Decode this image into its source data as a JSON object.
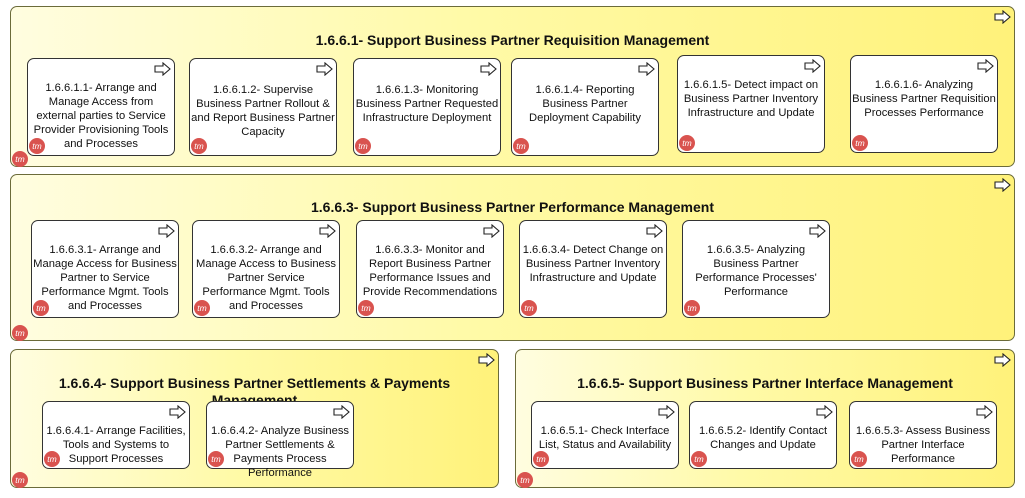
{
  "badge": "tm",
  "groups": [
    {
      "title": "1.6.6.1- Support Business Partner Requisition Management",
      "processes": [
        "1.6.6.1.1- Arrange and Manage Access from external parties to Service Provider Provisioning Tools and Processes",
        "1.6.6.1.2- Supervise Business Partner Rollout & and Report Business Partner Capacity",
        "1.6.6.1.3- Monitoring Business Partner Requested Infrastructure Deployment",
        "1.6.6.1.4- Reporting Business Partner Deployment Capability",
        "1.6.6.1.5- Detect impact on Business Partner Inventory Infrastructure and Update",
        "1.6.6.1.6- Analyzing Business Partner Requisition Processes Performance"
      ]
    },
    {
      "title": "1.6.6.3- Support Business Partner Performance Management",
      "processes": [
        "1.6.6.3.1- Arrange and Manage Access for Business Partner to Service Performance Mgmt. Tools and Processes",
        "1.6.6.3.2- Arrange and Manage Access to Business Partner Service Performance Mgmt. Tools and Processes",
        "1.6.6.3.3- Monitor and Report Business Partner Performance Issues and Provide Recommendations",
        "1.6.6.3.4- Detect Change on Business Partner Inventory Infrastructure and Update",
        "1.6.6.3.5- Analyzing Business Partner Performance Processes' Performance"
      ]
    },
    {
      "title": "1.6.6.4- Support Business Partner Settlements & Payments Management",
      "processes": [
        "1.6.6.4.1- Arrange Facilities, Tools and Systems to Support Processes",
        "1.6.6.4.2- Analyze Business Partner Settlements & Payments Process Performance"
      ]
    },
    {
      "title": "1.6.6.5- Support Business Partner Interface Management",
      "processes": [
        "1.6.6.5.1- Check Interface List, Status and Availability",
        "1.6.6.5.2- Identify Contact Changes and Update",
        "1.6.6.5.3- Assess Business Partner Interface Performance"
      ]
    }
  ]
}
